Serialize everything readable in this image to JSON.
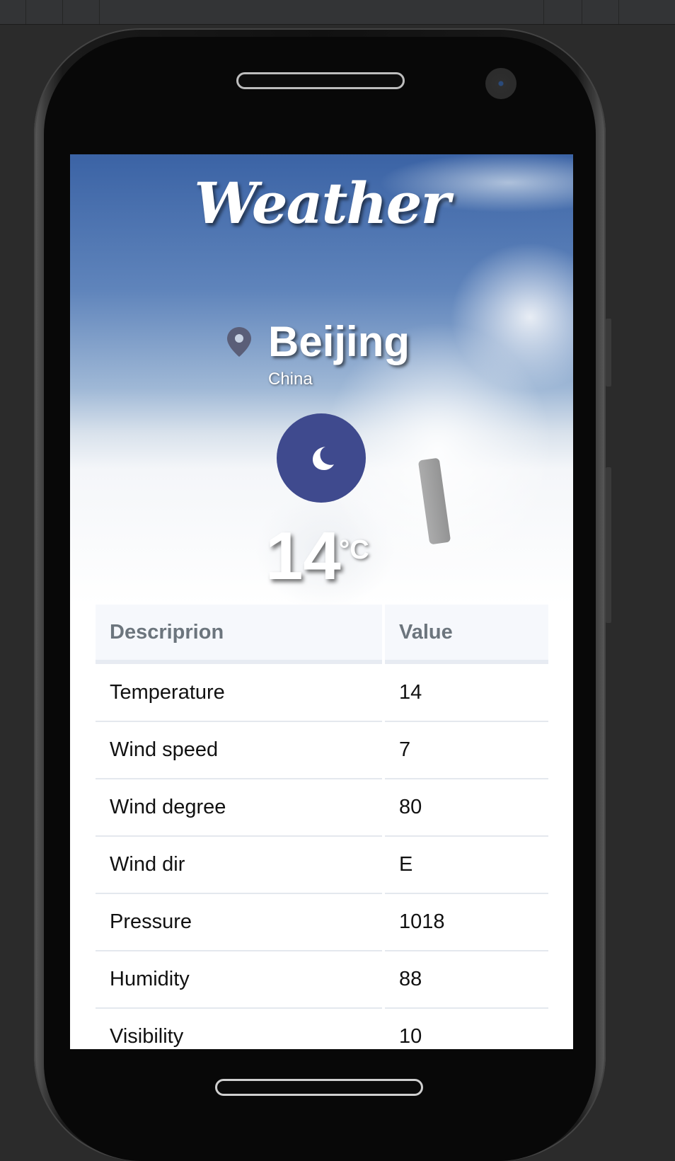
{
  "app": {
    "title": "Weather"
  },
  "location": {
    "city": "Beijing",
    "country": "China"
  },
  "current": {
    "icon": "moon-icon",
    "temperature": "14",
    "unit": "°C"
  },
  "table": {
    "headers": {
      "description": "Descriprion",
      "value": "Value"
    },
    "rows": [
      {
        "label": "Temperature",
        "value": "14"
      },
      {
        "label": "Wind speed",
        "value": "7"
      },
      {
        "label": "Wind degree",
        "value": "80"
      },
      {
        "label": "Wind dir",
        "value": "E"
      },
      {
        "label": "Pressure",
        "value": "1018"
      },
      {
        "label": "Humidity",
        "value": "88"
      },
      {
        "label": "Visibility",
        "value": "10"
      }
    ]
  },
  "colors": {
    "icon_circle": "#3f4a8e",
    "pin": "#5a5e78",
    "header_bg": "#f6f8fc",
    "header_text": "#6c757d"
  }
}
